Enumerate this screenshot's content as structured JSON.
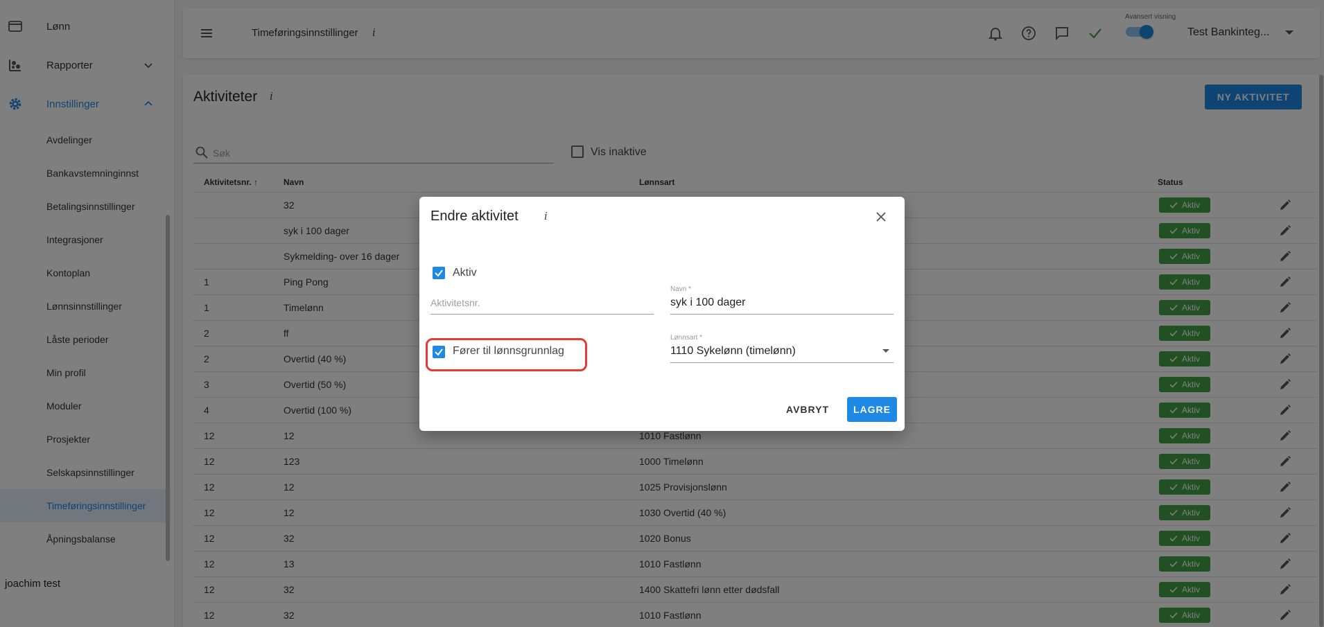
{
  "sidebar": {
    "nav": [
      {
        "label": "Lønn",
        "icon": "wallet-icon"
      },
      {
        "label": "Rapporter",
        "icon": "reports-icon"
      },
      {
        "label": "Innstillinger",
        "icon": "gear-icon"
      }
    ],
    "sub_items": [
      "Avdelinger",
      "Bankavstemninginnst",
      "Betalingsinnstillinger",
      "Integrasjoner",
      "Kontoplan",
      "Lønnsinnstillinger",
      "Låste perioder",
      "Min profil",
      "Moduler",
      "Prosjekter",
      "Selskapsinnstillinger",
      "Timeføringsinnstillinger",
      "Åpningsbalanse"
    ],
    "selected_item": "Timeføringsinnstillinger",
    "user_name": "joachim test"
  },
  "topbar": {
    "title": "Timeføringsinnstillinger",
    "info": "i",
    "advanced_label": "Avansert visning",
    "advanced_on": true,
    "company": "Test Bankinteg..."
  },
  "page": {
    "title": "Aktiviteter",
    "info": "i",
    "new_button": "NY AKTIVITET",
    "search_placeholder": "Søk",
    "show_inactive_label": "Vis inaktive"
  },
  "table": {
    "headers": {
      "nr": "Aktivitetsnr.",
      "navn": "Navn",
      "lonnsart": "Lønnsart",
      "status": "Status"
    },
    "status_label": "Aktiv",
    "rows": [
      {
        "nr": "",
        "navn": "32",
        "lonnsart": ""
      },
      {
        "nr": "",
        "navn": "syk i 100 dager",
        "lonnsart": ""
      },
      {
        "nr": "",
        "navn": "Sykmelding- over 16 dager",
        "lonnsart": ""
      },
      {
        "nr": "1",
        "navn": "Ping Pong",
        "lonnsart": ""
      },
      {
        "nr": "1",
        "navn": "Timelønn",
        "lonnsart": ""
      },
      {
        "nr": "2",
        "navn": "ff",
        "lonnsart": ""
      },
      {
        "nr": "2",
        "navn": "Overtid (40 %)",
        "lonnsart": ""
      },
      {
        "nr": "3",
        "navn": "Overtid (50 %)",
        "lonnsart": ""
      },
      {
        "nr": "4",
        "navn": "Overtid (100 %)",
        "lonnsart": ""
      },
      {
        "nr": "12",
        "navn": "12",
        "lonnsart": "1010 Fastlønn"
      },
      {
        "nr": "12",
        "navn": "123",
        "lonnsart": "1000 Timelønn"
      },
      {
        "nr": "12",
        "navn": "12",
        "lonnsart": "1025 Provisjonslønn"
      },
      {
        "nr": "12",
        "navn": "12",
        "lonnsart": "1030 Overtid (40 %)"
      },
      {
        "nr": "12",
        "navn": "32",
        "lonnsart": "1020 Bonus"
      },
      {
        "nr": "12",
        "navn": "13",
        "lonnsart": "1010 Fastlønn"
      },
      {
        "nr": "12",
        "navn": "32",
        "lonnsart": "1400 Skattefri lønn etter dødsfall"
      },
      {
        "nr": "12",
        "navn": "32",
        "lonnsart": "1010 Fastlønn"
      }
    ]
  },
  "dialog": {
    "title": "Endre aktivitet",
    "info": "i",
    "aktiv_label": "Aktiv",
    "aktiv_checked": true,
    "nr_placeholder": "Aktivitetsnr.",
    "navn_label": "Navn *",
    "navn_value": "syk i 100 dager",
    "forer_label": "Fører til lønnsgrunnlag",
    "forer_checked": true,
    "lonnsart_label": "Lønnsart *",
    "lonnsart_value": "1110 Sykelønn (timelønn)",
    "cancel_label": "AVBRYT",
    "save_label": "LAGRE"
  },
  "colors": {
    "accent": "#1e88e5",
    "status_green": "#43a047",
    "highlight": "#e53935"
  }
}
